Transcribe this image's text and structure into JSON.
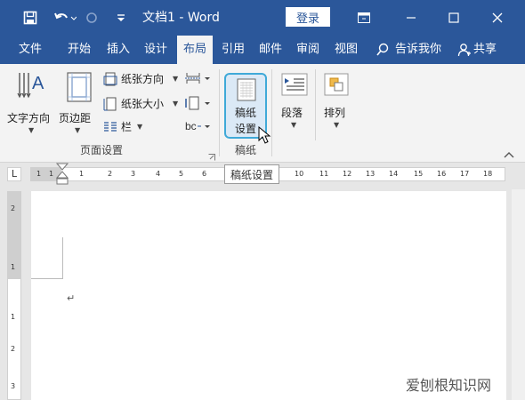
{
  "titlebar": {
    "title": "文档1 - Word",
    "login_label": "登录"
  },
  "tabs": [
    "文件",
    "开始",
    "插入",
    "设计",
    "布局",
    "引用",
    "邮件",
    "审阅",
    "视图"
  ],
  "active_tab": "布局",
  "tell_me": "告诉我你",
  "share": "共享",
  "ribbon": {
    "text_direction": "文字方向",
    "margins": "页边距",
    "orientation": "纸张方向",
    "size": "纸张大小",
    "columns": "栏",
    "page_setup_group": "页面设置",
    "gozi_setup_line1": "稿纸",
    "gozi_setup_line2": "设置",
    "gozi_group": "稿纸",
    "paragraph": "段落",
    "arrange": "排列"
  },
  "tooltip": "稿纸设置",
  "ruler": {
    "tab_selector": "L",
    "h_numbers": [
      "1",
      "1",
      "1",
      "2",
      "3",
      "4",
      "5",
      "6",
      "10",
      "11",
      "12",
      "13",
      "14",
      "15",
      "16",
      "17",
      "18"
    ],
    "v_numbers": [
      "2",
      "1",
      "1",
      "2",
      "3"
    ]
  },
  "document": {
    "paragraph_mark": "↵"
  },
  "watermark": "爱刨根知识网",
  "colors": {
    "accent": "#2b579a",
    "ribbon_bg": "#f3f3f3",
    "highlight_border": "#3fa9d8"
  }
}
